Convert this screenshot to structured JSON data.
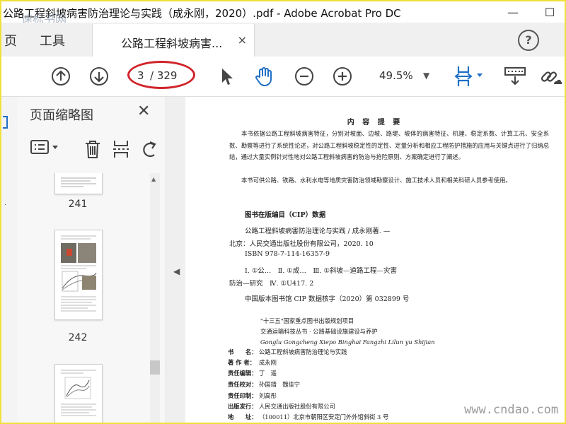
{
  "window": {
    "title": "公路工程斜坡病害防治理论与实践（成永刚，2020）.pdf - Adobe Acrobat Pro DC",
    "minimize": "—",
    "maximize": "☐"
  },
  "tabs": {
    "home": "页",
    "tools": "工具",
    "document": "公路工程斜坡病害...",
    "close": "×",
    "help": "?"
  },
  "toolbar": {
    "page_current": "3",
    "page_total": "/ 329",
    "zoom": "49.5%",
    "zoom_arrow": "▼"
  },
  "thumb_panel": {
    "title": "页面缩略图",
    "close": "✕",
    "thumbnails": [
      {
        "label": "241"
      },
      {
        "label": "242"
      }
    ]
  },
  "document": {
    "heading": "内 容 提 要",
    "para1": "本书依据公路工程斜坡病害特征，分别对坡面、边坡、路堤、坡体的病害特征、机理、稳定系数、计算工况、安全系数、勘察等进行了系统性论述，对公路工程斜坡稳定性的定性、定量分析和相应工程防护措施的应用与关键点进行了归纳总结，通过大量实例针对性地对公路工程斜坡病害的防治与抢险原则、方案确定进行了阐述。",
    "para2": "本书可供公路、铁路、水利水电等地质灾害防治领域勘察设计、施工技术人员和相关科研人员参考使用。",
    "cip_title": "图书在版编目（CIP）数据",
    "cip_lines": [
      "公路工程斜坡病害防治理论与实践 / 成永刚著. —",
      "北京：人民交通出版社股份有限公司，2020. 10",
      "ISBN 978-7-114-16357-9",
      "Ⅰ. ①公…　Ⅱ. ①成…　Ⅲ. ①斜坡—道路工程—灾害",
      "防治—研究　Ⅳ. ①U417. 2",
      "中国版本图书馆 CIP 数据核字（2020）第 032899 号"
    ],
    "series_lines": [
      "\"十三五\"国家重点图书出版规划项目",
      "交通运输科技丛书 · 公路基础设施建设与养护",
      "Gonglu Gongcheng Xiepo Binghai Fangzhi Lilun yu Shijian"
    ],
    "meta": [
      {
        "label": "书　　名：",
        "value": "公路工程斜坡病害防治理论与实践"
      },
      {
        "label": "著 作 者：",
        "value": "成永刚"
      },
      {
        "label": "责任编辑：",
        "value": "丁　遥"
      },
      {
        "label": "责任校对：",
        "value": "孙国靖　魏佳宁"
      },
      {
        "label": "责任印制：",
        "value": "刘高彤"
      },
      {
        "label": "出版发行：",
        "value": "人民交通出版社股份有限公司"
      },
      {
        "label": "地　　址：",
        "value": "（100011）北京市朝阳区安定门外外馆斜街 3 号"
      }
    ]
  },
  "watermarks": {
    "top_left": "速标书网",
    "bottom_right": "www.cndao.com"
  },
  "colors": {
    "accent_blue": "#1f6fc5",
    "annotation_red": "#d0232a",
    "frame_yellow": "#f1e03a"
  }
}
